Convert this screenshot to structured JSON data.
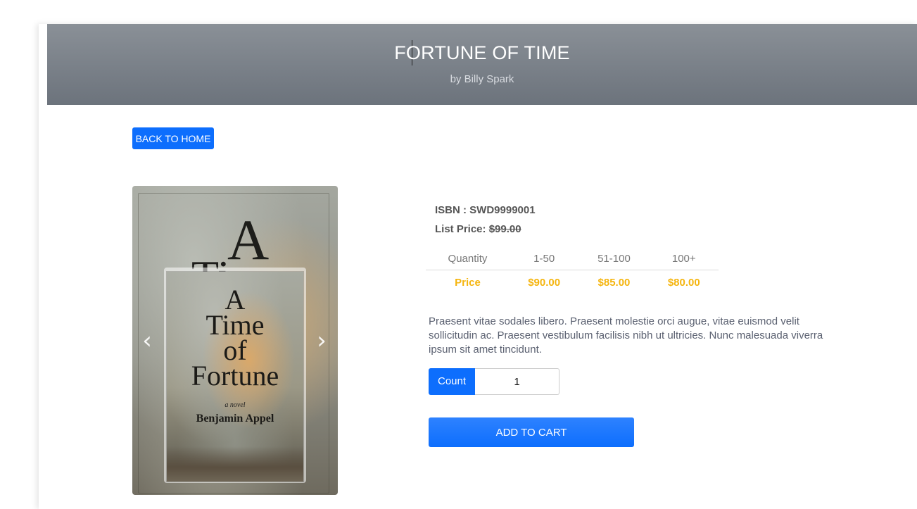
{
  "header": {
    "title": "FORTUNE OF TIME",
    "subtitle": "by Billy Spark"
  },
  "nav": {
    "back_label": "BACK TO HOME"
  },
  "carousel": {
    "cover_big_a": "A",
    "cover_big_t": "Ti",
    "thumb_title_lines": [
      "A",
      "Time",
      "of",
      "Fortune"
    ],
    "thumb_subtitle": "a novel",
    "thumb_author": "Benjamin Appel",
    "prev_icon": "chevron-left-icon",
    "next_icon": "chevron-right-icon"
  },
  "product": {
    "isbn_label": "ISBN : SWD9999001",
    "list_price_label": "List Price:",
    "list_price_value": "$99.00",
    "pricing": {
      "headers": [
        "Quantity",
        "1-50",
        "51-100",
        "100+"
      ],
      "row": [
        "Price",
        "$90.00",
        "$85.00",
        "$80.00"
      ]
    },
    "description": "Praesent vitae sodales libero. Praesent molestie orci augue, vitae euismod velit sollicitudin ac. Praesent vestibulum facilisis nibh ut ultricies. Nunc malesuada viverra ipsum sit amet tincidunt.",
    "count_label": "Count",
    "count_value": "1",
    "add_to_cart_label": "ADD TO CART"
  },
  "colors": {
    "accent": "#0d6efd",
    "price": "#f5b50f",
    "banner": "#7a8189"
  }
}
